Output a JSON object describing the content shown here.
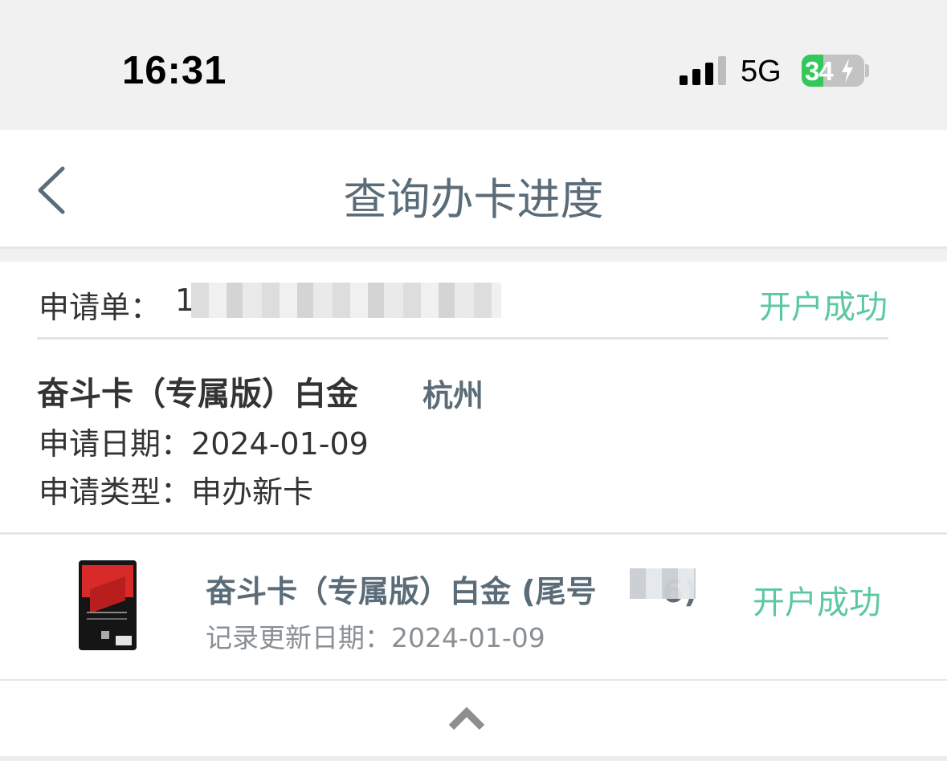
{
  "status_bar": {
    "time": "16:31",
    "network": "5G",
    "battery": "34",
    "battery_level_percent": 34,
    "icons": [
      "signal-icon",
      "battery-charging-icon"
    ]
  },
  "nav": {
    "title": "查询办卡进度",
    "back_icon": "chevron-left-icon"
  },
  "application": {
    "label": "申请单：",
    "number_visible": "1",
    "status": "开户成功",
    "card_name": "奋斗卡（专属版）白金",
    "city": "杭州",
    "date_label": "申请日期：",
    "date_value": "2024-01-09",
    "type_label": "申请类型：",
    "type_value": "申办新卡"
  },
  "card_record": {
    "title": "奋斗卡（专属版）白金 (尾号",
    "title_end": "6)",
    "update_label": "记录更新日期：",
    "update_value": "2024-01-09",
    "status": "开户成功"
  },
  "colors": {
    "success": "#5cc8a0",
    "title": "#5b6c79",
    "text": "#333333",
    "muted": "#8a8f94"
  }
}
